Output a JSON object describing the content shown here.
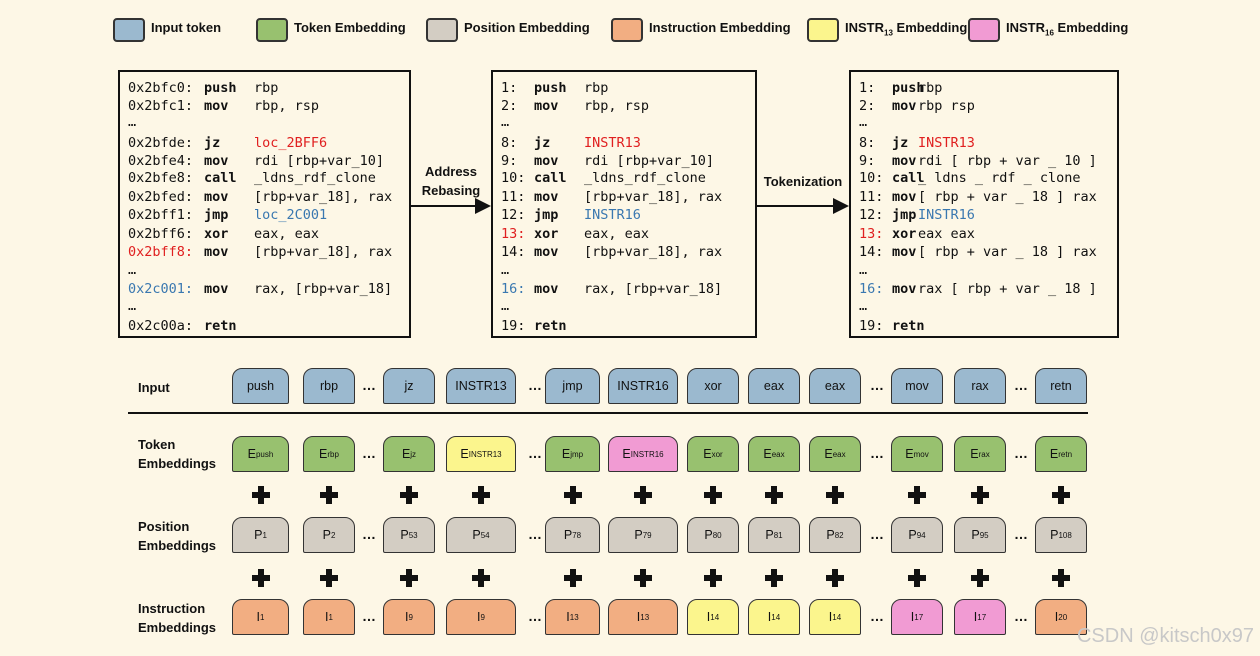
{
  "legend": [
    {
      "label": "Input token",
      "color": "#9bb9cf"
    },
    {
      "label": "Token Embedding",
      "color": "#98c16f"
    },
    {
      "label": "Position Embedding",
      "color": "#d3cdc3"
    },
    {
      "label": "Instruction Embedding",
      "color": "#f2ae82"
    },
    {
      "label_main": "INSTR",
      "label_sub": "13",
      "label_tail": " Embedding",
      "color": "#fbf58d"
    },
    {
      "label_main": "INSTR",
      "label_sub": "16",
      "label_tail": " Embedding",
      "color": "#f19bd3"
    }
  ],
  "arrows": {
    "rebasing": "Address\nRebasing",
    "tokenization": "Tokenization"
  },
  "code_original": [
    {
      "addr": "0x2bfc0:",
      "op": "push",
      "args": "rbp"
    },
    {
      "addr": "0x2bfc1:",
      "op": "mov",
      "args": "rbp, rsp"
    },
    {
      "addr": "…",
      "op": "",
      "args": ""
    },
    {
      "addr": "0x2bfde:",
      "op": "jz",
      "args": "loc_2BFF6"
    },
    {
      "addr": "0x2bfe4:",
      "op": "mov",
      "args": "rdi [rbp+var_10]"
    },
    {
      "addr": "0x2bfe8:",
      "op": "call",
      "args": "_ldns_rdf_clone"
    },
    {
      "addr": "0x2bfed:",
      "op": "mov",
      "args": "[rbp+var_18], rax"
    },
    {
      "addr": "0x2bff1:",
      "op": "jmp",
      "args": "loc_2C001"
    },
    {
      "addr": "0x2bff6:",
      "op": "xor",
      "args": "eax, eax"
    },
    {
      "addr": "0x2bff8:",
      "op": "mov",
      "args": "[rbp+var_18], rax"
    },
    {
      "addr": "…",
      "op": "",
      "args": ""
    },
    {
      "addr": "0x2c001:",
      "op": "mov",
      "args": "rax, [rbp+var_18]"
    },
    {
      "addr": "…",
      "op": "",
      "args": ""
    },
    {
      "addr": "0x2c00a:",
      "op": "retn",
      "args": ""
    }
  ],
  "code_rebased": [
    {
      "addr": "1:",
      "op": "push",
      "args": "rbp"
    },
    {
      "addr": "2:",
      "op": "mov",
      "args": "rbp, rsp"
    },
    {
      "addr": "…",
      "op": "",
      "args": ""
    },
    {
      "addr": "8:",
      "op": "jz",
      "args": "INSTR13"
    },
    {
      "addr": "9:",
      "op": "mov",
      "args": "rdi [rbp+var_10]"
    },
    {
      "addr": "10:",
      "op": "call",
      "args": "_ldns_rdf_clone"
    },
    {
      "addr": "11:",
      "op": "mov",
      "args": "[rbp+var_18], rax"
    },
    {
      "addr": "12:",
      "op": "jmp",
      "args": "INSTR16"
    },
    {
      "addr": "13:",
      "op": "xor",
      "args": "eax, eax"
    },
    {
      "addr": "14:",
      "op": "mov",
      "args": "[rbp+var_18], rax"
    },
    {
      "addr": "…",
      "op": "",
      "args": ""
    },
    {
      "addr": "16:",
      "op": "mov",
      "args": "rax, [rbp+var_18]"
    },
    {
      "addr": "…",
      "op": "",
      "args": ""
    },
    {
      "addr": "19:",
      "op": "retn",
      "args": ""
    }
  ],
  "code_tokenized": [
    {
      "addr": "1:",
      "op": "push",
      "args": "rbp"
    },
    {
      "addr": "2:",
      "op": "mov",
      "args": "rbp rsp"
    },
    {
      "addr": "…",
      "op": "",
      "args": ""
    },
    {
      "addr": "8:",
      "op": "jz",
      "args": "INSTR13"
    },
    {
      "addr": "9:",
      "op": "mov",
      "args": "rdi [ rbp + var _ 10 ]"
    },
    {
      "addr": "10:",
      "op": "call",
      "args": "_ ldns _ rdf _ clone"
    },
    {
      "addr": "11:",
      "op": "mov",
      "args": "[ rbp + var _ 18 ] rax"
    },
    {
      "addr": "12:",
      "op": "jmp",
      "args": "INSTR16"
    },
    {
      "addr": "13:",
      "op": "xor",
      "args": "eax eax"
    },
    {
      "addr": "14:",
      "op": "mov",
      "args": "[ rbp + var _ 18 ] rax"
    },
    {
      "addr": "…",
      "op": "",
      "args": ""
    },
    {
      "addr": "16:",
      "op": "mov",
      "args": "rax [ rbp + var _ 18 ]"
    },
    {
      "addr": "…",
      "op": "",
      "args": ""
    },
    {
      "addr": "19:",
      "op": "retn",
      "args": ""
    }
  ],
  "rows": {
    "input_label": "Input",
    "token_label": "Token\nEmbeddings",
    "position_label": "Position\nEmbeddings",
    "instruction_label": "Instruction\nEmbeddings",
    "ellipsis": "…",
    "input": [
      "push",
      "rbp",
      "jz",
      "INSTR13",
      "jmp",
      "INSTR16",
      "xor",
      "eax",
      "eax",
      "mov",
      "rax",
      "retn"
    ],
    "token": [
      {
        "main": "E",
        "sub": "push",
        "color": "#98c16f"
      },
      {
        "main": "E",
        "sub": "rbp",
        "color": "#98c16f"
      },
      {
        "main": "E",
        "sub": "jz",
        "color": "#98c16f"
      },
      {
        "main": "E",
        "sub": "INSTR13",
        "color": "#fbf58d"
      },
      {
        "main": "E",
        "sub": "jmp",
        "color": "#98c16f"
      },
      {
        "main": "E",
        "sub": "INSTR16",
        "color": "#f19bd3"
      },
      {
        "main": "E",
        "sub": "xor",
        "color": "#98c16f"
      },
      {
        "main": "E",
        "sub": "eax",
        "color": "#98c16f"
      },
      {
        "main": "E",
        "sub": "eax",
        "color": "#98c16f"
      },
      {
        "main": "E",
        "sub": "mov",
        "color": "#98c16f"
      },
      {
        "main": "E",
        "sub": "rax",
        "color": "#98c16f"
      },
      {
        "main": "E",
        "sub": "retn",
        "color": "#98c16f"
      }
    ],
    "position": [
      {
        "main": "P",
        "sub": "1"
      },
      {
        "main": "P",
        "sub": "2"
      },
      {
        "main": "P",
        "sub": "53"
      },
      {
        "main": "P",
        "sub": "54"
      },
      {
        "main": "P",
        "sub": "78"
      },
      {
        "main": "P",
        "sub": "79"
      },
      {
        "main": "P",
        "sub": "80"
      },
      {
        "main": "P",
        "sub": "81"
      },
      {
        "main": "P",
        "sub": "82"
      },
      {
        "main": "P",
        "sub": "94"
      },
      {
        "main": "P",
        "sub": "95"
      },
      {
        "main": "P",
        "sub": "108"
      }
    ],
    "instruction": [
      {
        "main": "I",
        "sub": "1",
        "color": "#f2ae82"
      },
      {
        "main": "I",
        "sub": "1",
        "color": "#f2ae82"
      },
      {
        "main": "I",
        "sub": "9",
        "color": "#f2ae82"
      },
      {
        "main": "I",
        "sub": "9",
        "color": "#f2ae82"
      },
      {
        "main": "I",
        "sub": "13",
        "color": "#f2ae82"
      },
      {
        "main": "I",
        "sub": "13",
        "color": "#f2ae82"
      },
      {
        "main": "I",
        "sub": "14",
        "color": "#fbf58d"
      },
      {
        "main": "I",
        "sub": "14",
        "color": "#fbf58d"
      },
      {
        "main": "I",
        "sub": "14",
        "color": "#fbf58d"
      },
      {
        "main": "I",
        "sub": "17",
        "color": "#f19bd3"
      },
      {
        "main": "I",
        "sub": "17",
        "color": "#f19bd3"
      },
      {
        "main": "I",
        "sub": "20",
        "color": "#f2ae82"
      }
    ]
  },
  "watermark": "CSDN @kitsch0x97"
}
